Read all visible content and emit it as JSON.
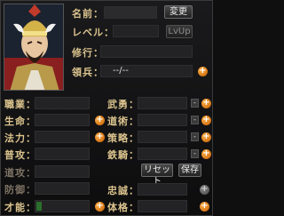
{
  "header": {
    "name_label": "名前：",
    "change_button": "変更",
    "level_label": "レベル：",
    "levelup_button": "LvUp",
    "practice_label": "修行：",
    "territory_label": "領兵：",
    "territory_value": "--/--"
  },
  "stats_left": [
    {
      "label": "職業："
    },
    {
      "label": "生命："
    },
    {
      "label": "法力："
    },
    {
      "label": "普攻："
    },
    {
      "label": "道攻："
    },
    {
      "label": "防御："
    },
    {
      "label": "才能："
    }
  ],
  "stats_right": [
    {
      "label": "武勇："
    },
    {
      "label": "道術："
    },
    {
      "label": "策略："
    },
    {
      "label": "鉄騎："
    },
    {
      "label": "忠誠："
    },
    {
      "label": "体格："
    }
  ],
  "buttons": {
    "reset": "リセット",
    "save": "保存"
  },
  "icons": {
    "plus": "+",
    "minus": "-"
  },
  "colors": {
    "label": "#dcc48e",
    "plus_orange": "#e07a10",
    "talent_green": "#2b6e2b"
  }
}
